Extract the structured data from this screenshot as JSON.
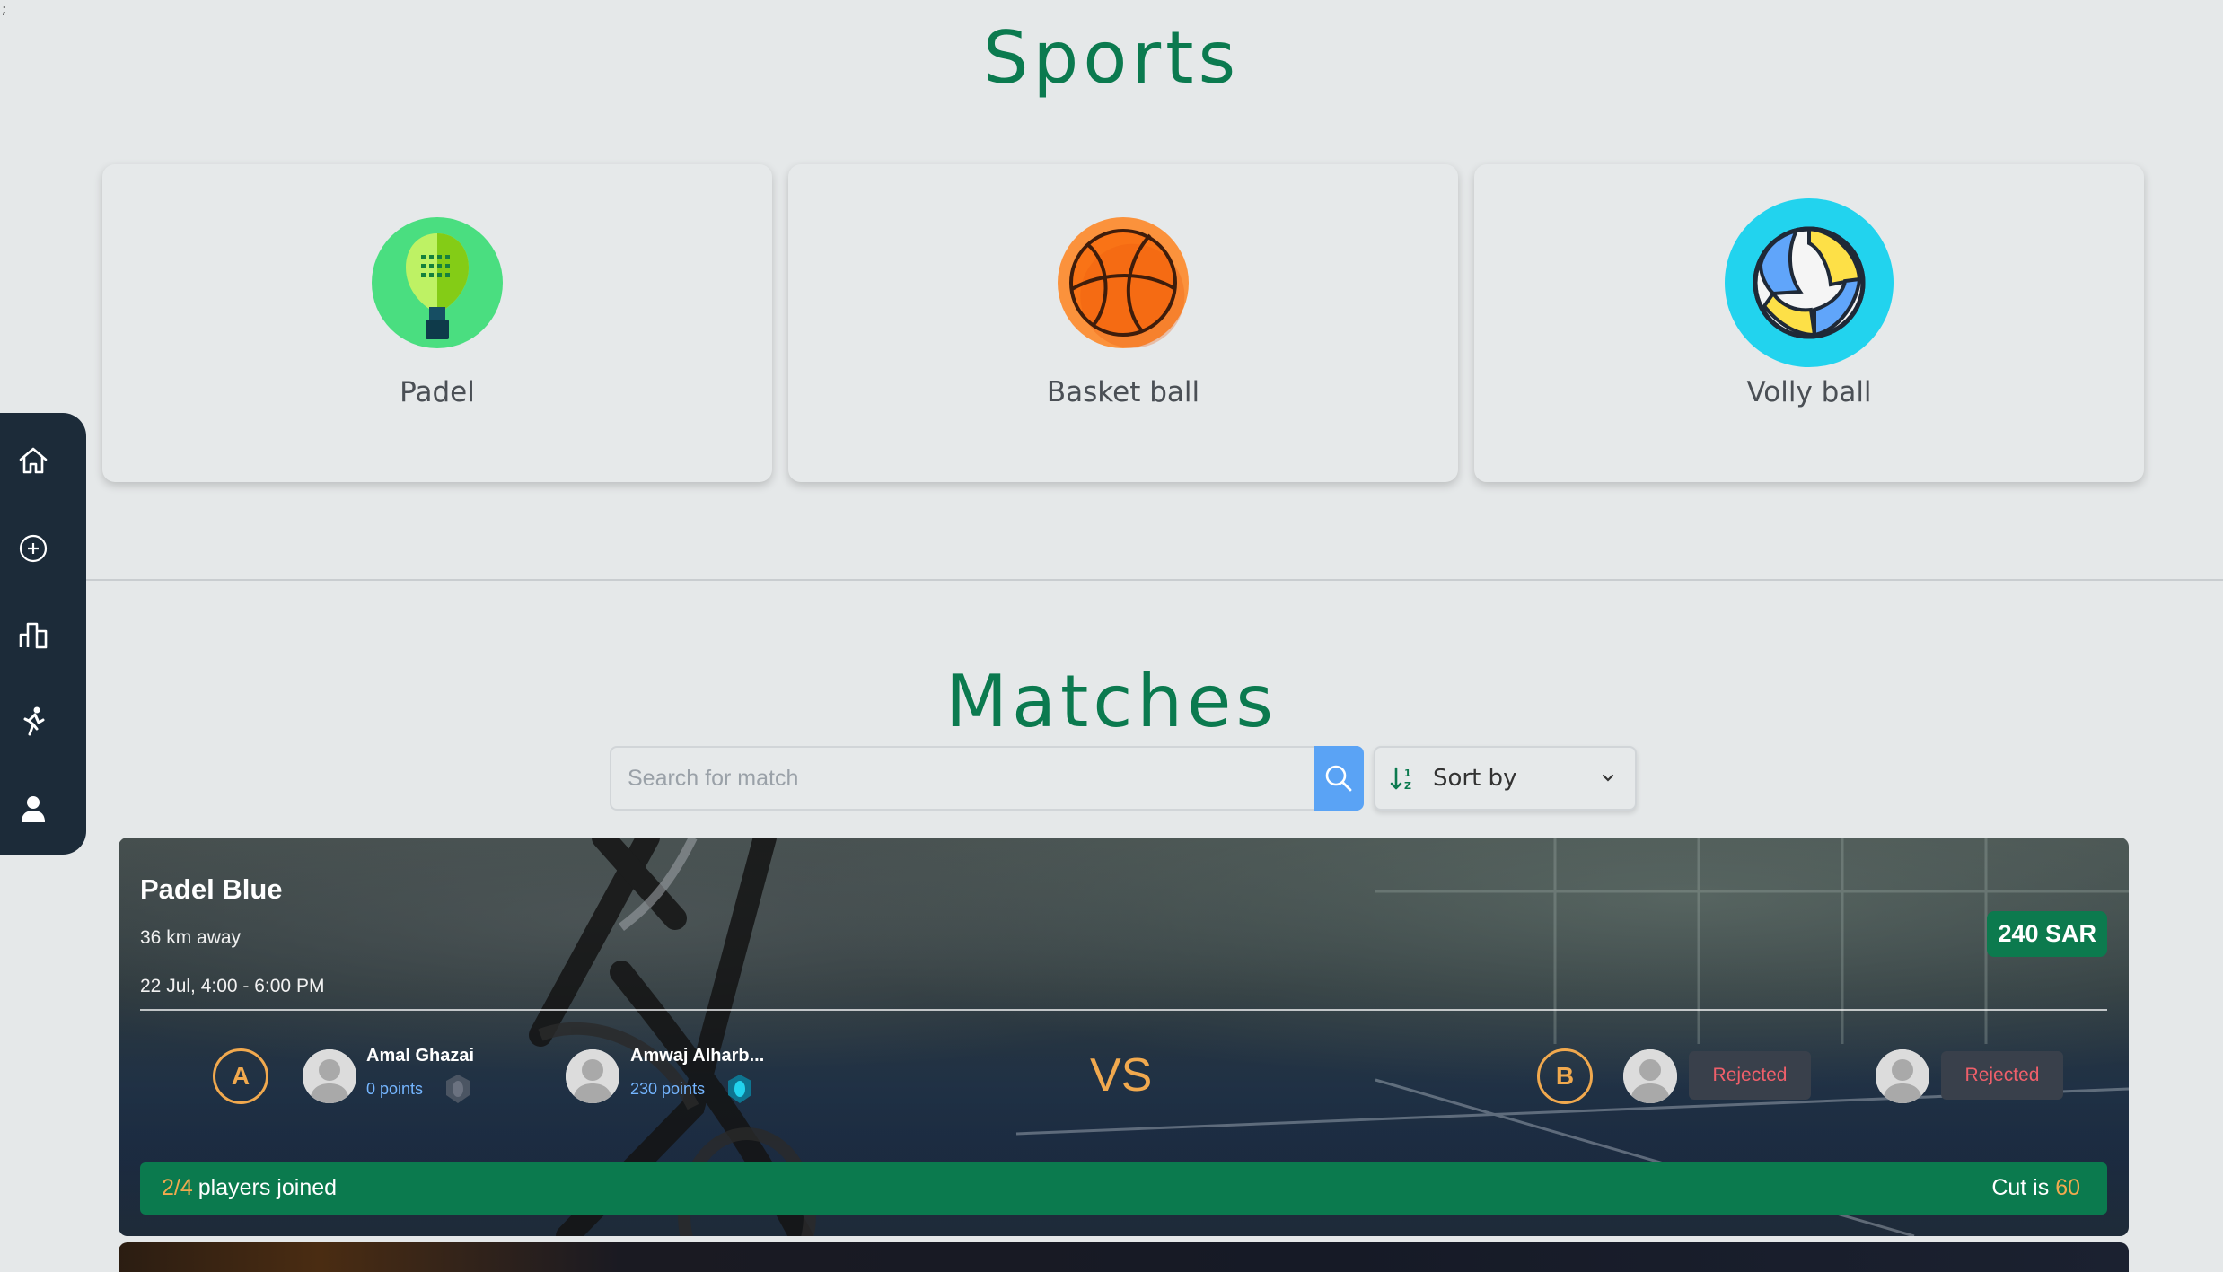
{
  "stray_text": ";",
  "sports": {
    "title": "Sports",
    "items": [
      {
        "name": "Padel",
        "icon": "padel-racket-icon",
        "color": "#4ade80"
      },
      {
        "name": "Basket ball",
        "icon": "basketball-icon",
        "color": "#f97316"
      },
      {
        "name": "Volly ball",
        "icon": "volleyball-icon",
        "color": "#22d3ee"
      }
    ]
  },
  "sidebar": {
    "items": [
      {
        "name": "home",
        "icon": "home-icon"
      },
      {
        "name": "add",
        "icon": "plus-circle-icon"
      },
      {
        "name": "stats",
        "icon": "bar-chart-icon"
      },
      {
        "name": "sports",
        "icon": "runner-icon"
      },
      {
        "name": "profile",
        "icon": "user-icon"
      }
    ]
  },
  "matches": {
    "title": "Matches",
    "search_placeholder": "Search for match",
    "sort_label": "Sort by",
    "items": [
      {
        "title": "Padel Blue",
        "distance": "36 km away",
        "time": "22 Jul, 4:00 - 6:00 PM",
        "price": "240 SAR",
        "vs": "VS",
        "team_a": {
          "label": "A",
          "players": [
            {
              "name": "Amal Ghazai",
              "points": "0 points",
              "medal_color": "#6b7280"
            },
            {
              "name": "Amwaj Alharb...",
              "points": "230 points",
              "medal_color": "#22d3ee"
            }
          ]
        },
        "team_b": {
          "label": "B",
          "players": [
            {
              "status": "Rejected"
            },
            {
              "status": "Rejected"
            }
          ]
        },
        "joined_count": "2/4",
        "joined_label": "players joined",
        "cut_label": "Cut is",
        "cut_value": "60"
      }
    ]
  },
  "colors": {
    "accent_green": "#0b7a4f",
    "accent_orange": "#f1a94e",
    "rejected_red": "#ef5f6a",
    "points_blue": "#74b5ff"
  }
}
